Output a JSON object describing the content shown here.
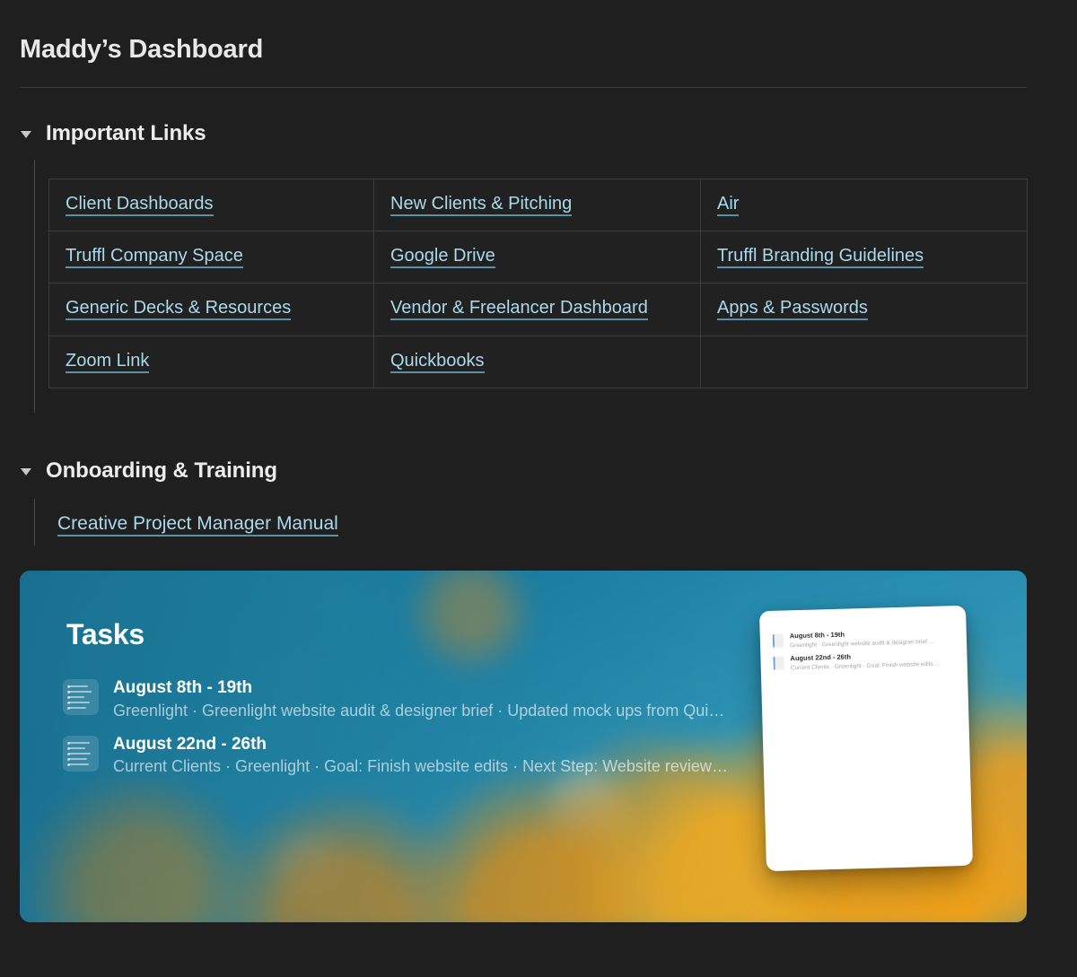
{
  "page": {
    "title": "Maddy’s Dashboard",
    "background_color": "#1f1f1f",
    "link_color": "#a9d9ea",
    "text_color": "#e8e8e8"
  },
  "sections": [
    {
      "id": "important-links",
      "toggle_icon": "triangle-down-icon",
      "heading": "Important Links",
      "expanded": true
    },
    {
      "id": "onboarding-training",
      "toggle_icon": "triangle-down-icon",
      "heading": "Onboarding & Training",
      "expanded": true
    }
  ],
  "links_table": {
    "rows": [
      [
        {
          "label": "Client Dashboards",
          "empty": false
        },
        {
          "label": "New Clients & Pitching",
          "empty": false
        },
        {
          "label": "Air",
          "empty": false
        }
      ],
      [
        {
          "label": "Truffl Company Space",
          "empty": false
        },
        {
          "label": "Google Drive",
          "empty": false
        },
        {
          "label": "Truffl Branding Guidelines",
          "empty": false
        }
      ],
      [
        {
          "label": "Generic Decks & Resources",
          "empty": false
        },
        {
          "label": "Vendor & Freelancer Dashboard",
          "empty": false
        },
        {
          "label": "Apps & Passwords",
          "empty": false
        }
      ],
      [
        {
          "label": "Zoom Link",
          "empty": false
        },
        {
          "label": "Quickbooks",
          "empty": false
        },
        {
          "label": "",
          "empty": true
        }
      ]
    ]
  },
  "onboarding": {
    "link_label": "Creative Project Manager Manual"
  },
  "banner": {
    "title": "Tasks",
    "background_image": "blurred-orange-poppies-on-teal-sky",
    "tasks": [
      {
        "thumb_icon": "task-list-thumbnail-icon",
        "date": "August 8th - 19th",
        "meta": "Greenlight · Greenlight website audit & designer brief · Updated mock ups from Quinn…"
      },
      {
        "thumb_icon": "task-list-thumbnail-icon",
        "date": "August 22nd - 26th",
        "meta": "Current Clients · Greenlight · Goal: Finish website edits · Next Step: Website review Fri…"
      }
    ],
    "preview_card": {
      "rows": [
        {
          "thumb_icon": "document-thumbnail-icon",
          "date": "August 8th - 19th",
          "meta": "Greenlight · Greenlight website audit & designer brief …"
        },
        {
          "thumb_icon": "document-thumbnail-icon",
          "date": "August 22nd - 26th",
          "meta": "Current Clients · Greenlight · Goal: Finish website edits …"
        }
      ]
    }
  }
}
